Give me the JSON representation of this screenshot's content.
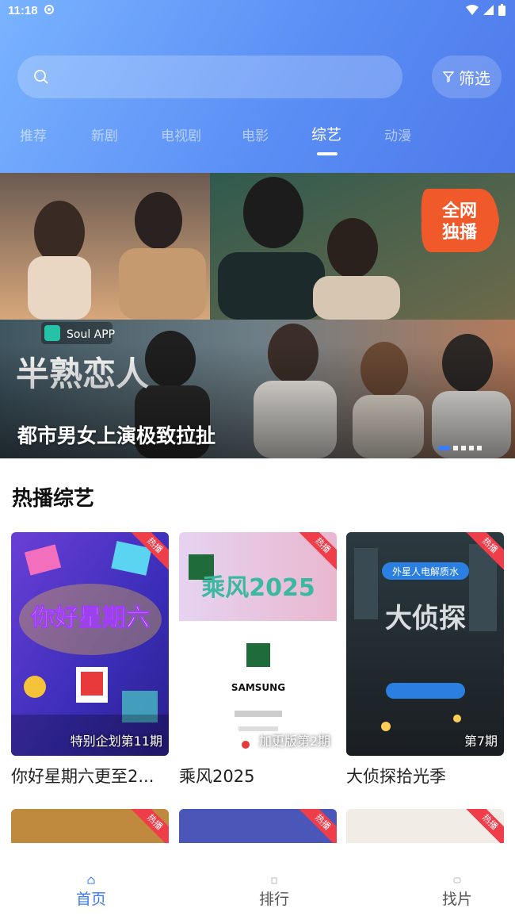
{
  "status_bar": {
    "time": "11:18"
  },
  "search": {
    "placeholder": ""
  },
  "filter": {
    "label": "筛选"
  },
  "tabs": [
    {
      "label": "推荐"
    },
    {
      "label": "新剧"
    },
    {
      "label": "电视剧"
    },
    {
      "label": "电影"
    },
    {
      "label": "综艺",
      "active": true
    },
    {
      "label": "动漫"
    }
  ],
  "banner": {
    "title": "都市男女上演极致拉扯",
    "badge": "全网独播",
    "show_logo": "半熟恋人",
    "sponsor": "Soul APP",
    "dots_count": 5,
    "active_dot": 0
  },
  "section": {
    "title": "热播综艺"
  },
  "cards": [
    {
      "name": "你好星期六更至2...",
      "episode": "特别企划第11期",
      "hot": "热播",
      "poster_text": "你好星期六"
    },
    {
      "name": "乘风2025",
      "episode": "加更版第2期",
      "hot": "热播",
      "poster_text": "乘风2025"
    },
    {
      "name": "大侦探拾光季",
      "episode": "第7期",
      "hot": "热播",
      "poster_text": "大侦探"
    }
  ],
  "cards_row2": [
    {
      "hot": "热播"
    },
    {
      "hot": "热播"
    },
    {
      "hot": "热播"
    }
  ],
  "navbar": [
    {
      "label": "首页",
      "active": true
    },
    {
      "label": "排行"
    },
    {
      "label": "找片"
    }
  ],
  "colors": {
    "accent": "#3a7af3",
    "hot_badge": "#ef3d4a",
    "header_start": "#7ab3ff",
    "header_end": "#4d79ea"
  }
}
